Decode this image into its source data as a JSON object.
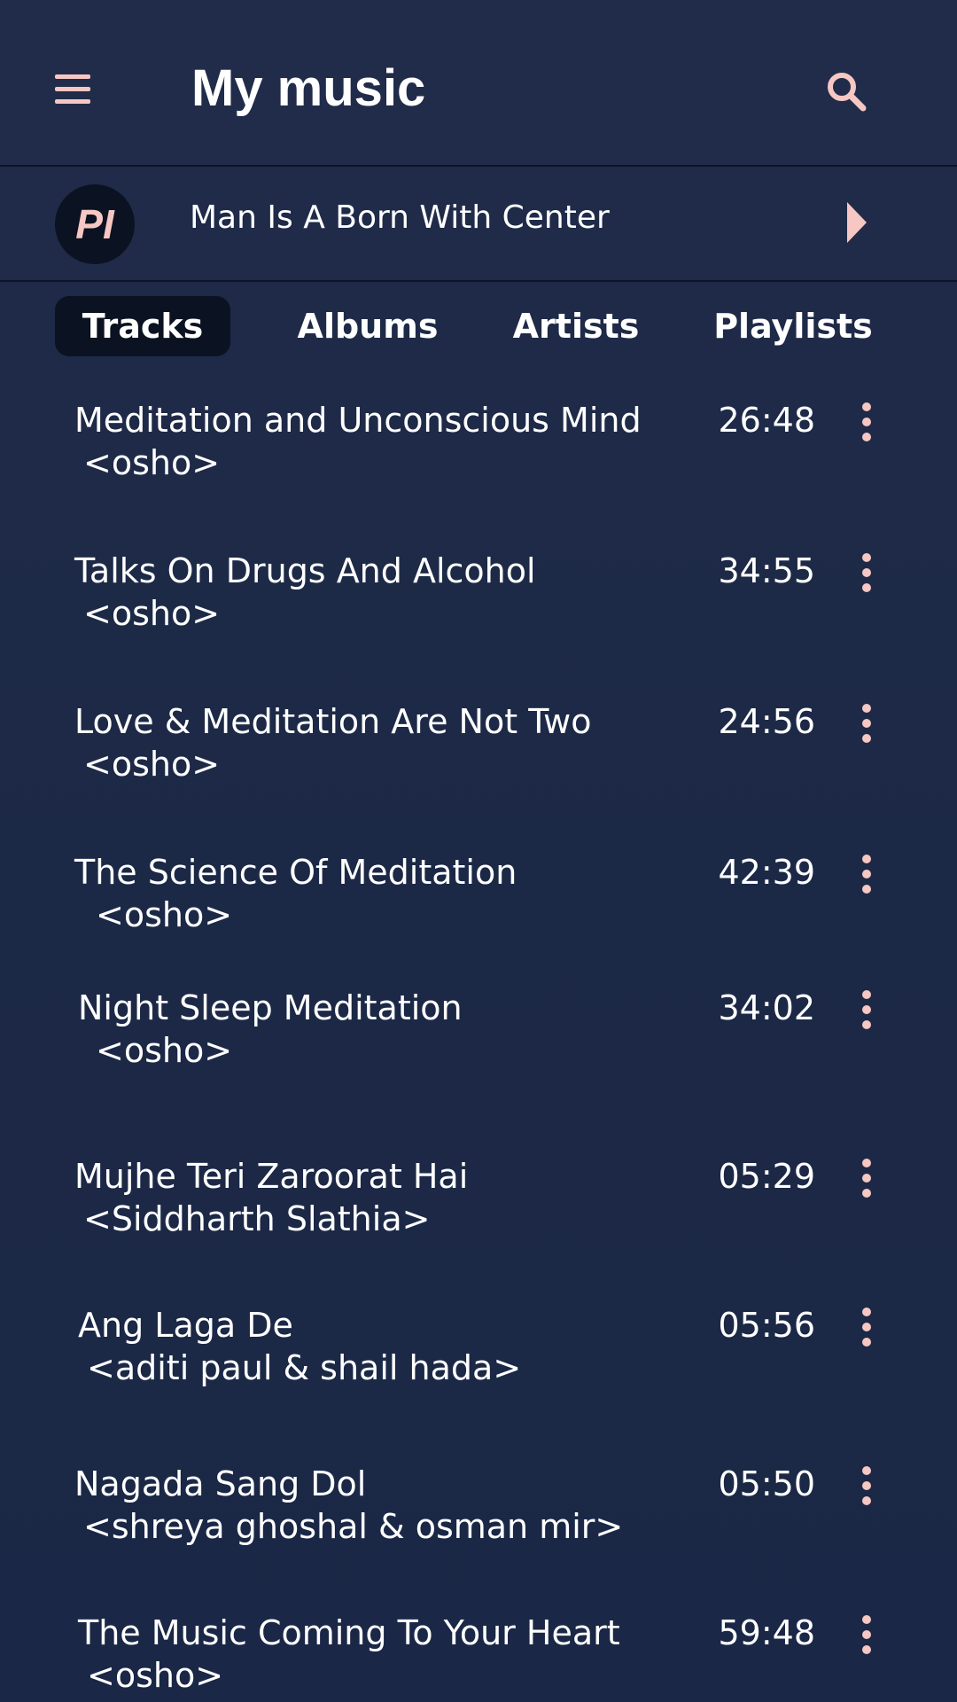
{
  "header": {
    "title": "My music"
  },
  "now_playing": {
    "avatar_text": "PI",
    "title": "Man Is A Born With Center"
  },
  "tabs": [
    {
      "label": "Tracks",
      "active": true
    },
    {
      "label": "Albums",
      "active": false
    },
    {
      "label": "Artists",
      "active": false
    },
    {
      "label": "Playlists",
      "active": false
    }
  ],
  "tracks": [
    {
      "title": "Meditation and Unconscious Mind",
      "artist": "<osho>",
      "duration": "26:48"
    },
    {
      "title": "Talks On Drugs And Alcohol",
      "artist": "<osho>",
      "duration": "34:55"
    },
    {
      "title": "Love & Meditation Are Not Two",
      "artist": "<osho>",
      "duration": "24:56"
    },
    {
      "title": "The Science Of Meditation",
      "artist": " <osho>",
      "duration": "42:39"
    },
    {
      "title": "Night Sleep Meditation",
      "artist": " <osho>",
      "duration": "34:02"
    },
    {
      "title": "Mujhe Teri Zaroorat Hai",
      "artist": "<Siddharth Slathia>",
      "duration": "05:29"
    },
    {
      "title": "Ang Laga De",
      "artist": "<aditi paul & shail hada>",
      "duration": "05:56"
    },
    {
      "title": "Nagada Sang Dol",
      "artist": "<shreya ghoshal & osman mir>",
      "duration": "05:50"
    },
    {
      "title": "The Music Coming To Your Heart",
      "artist": "<osho>",
      "duration": "59:48"
    }
  ],
  "colors": {
    "background": "#1b2744",
    "header": "#202c49",
    "accent": "#f6c7c3",
    "active_tab": "#0b1221",
    "text": "#ffffff"
  },
  "icons": {
    "menu": "hamburger-menu-icon",
    "search": "search-icon",
    "play": "play-icon",
    "more": "more-vertical-icon"
  }
}
